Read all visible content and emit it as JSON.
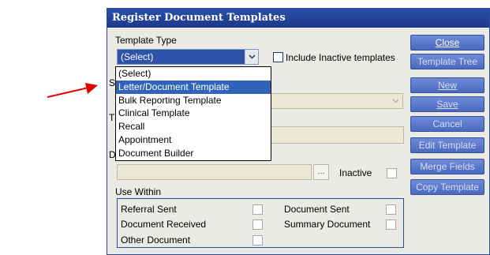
{
  "dialog": {
    "title": "Register Document Templates"
  },
  "template_type": {
    "label": "Template Type",
    "selected": "(Select)",
    "options": [
      "(Select)",
      "Letter/Document Template",
      "Bulk Reporting Template",
      "Clinical Template",
      "Recall",
      "Appointment",
      "Document Builder"
    ],
    "highlighted_index": 1
  },
  "include_inactive": {
    "label": "Include Inactive templates",
    "checked": false
  },
  "side_buttons": {
    "close": "Close",
    "template_tree": "Template Tree",
    "new": "New",
    "save": "Save",
    "cancel": "Cancel",
    "edit_template": "Edit Template",
    "merge_fields": "Merge Fields",
    "copy_template": "Copy Template"
  },
  "partial_labels": {
    "s": "S",
    "t": "T",
    "d": "D"
  },
  "inactive": {
    "label": "Inactive",
    "browse": "..."
  },
  "use_within": {
    "label": "Use Within",
    "items": [
      "Referral Sent",
      "Document Sent",
      "Document Received",
      "Summary Document",
      "Other Document"
    ]
  },
  "colors": {
    "titlebar": "#1d3a8a",
    "button": "#4a69c0",
    "arrow": "#e00000",
    "selection": "#3163b9"
  }
}
